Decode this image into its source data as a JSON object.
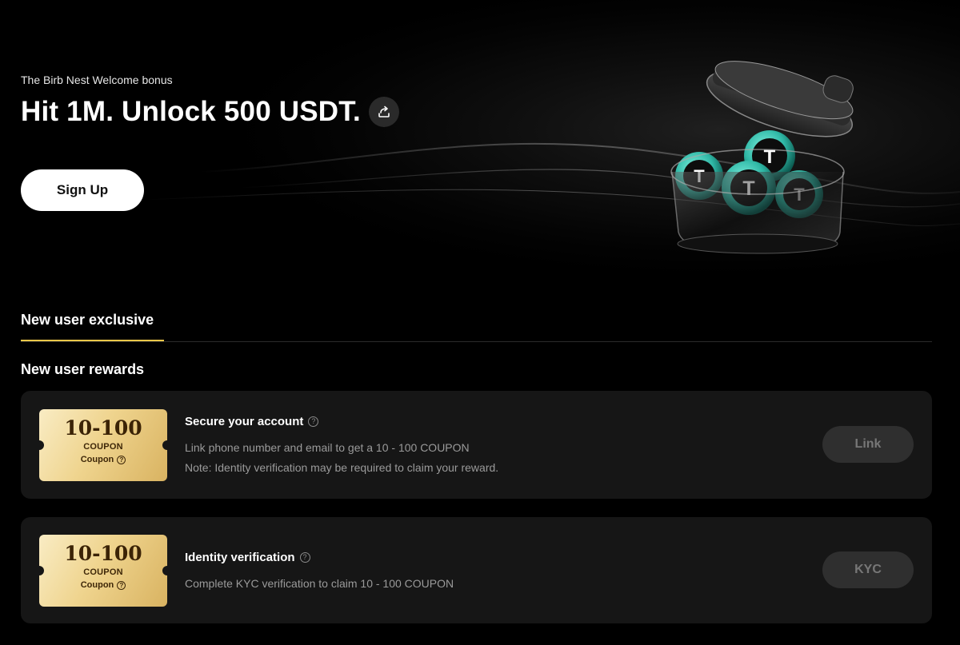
{
  "hero": {
    "subtitle": "The Birb Nest Welcome bonus",
    "headline": "Hit 1M. Unlock 500 USDT.",
    "share_icon": "share-icon",
    "signup_label": "Sign Up"
  },
  "tabs": [
    {
      "label": "New user exclusive",
      "active": true
    }
  ],
  "section_title": "New user rewards",
  "rewards": [
    {
      "coupon_amount": "10-100",
      "coupon_unit": "COUPON",
      "coupon_type": "Coupon",
      "title": "Secure your account",
      "desc1": "Link phone number and email to get a 10 - 100 COUPON",
      "desc2": "Note: Identity verification may be required to claim your reward.",
      "action_label": "Link"
    },
    {
      "coupon_amount": "10-100",
      "coupon_unit": "COUPON",
      "coupon_type": "Coupon",
      "title": "Identity verification",
      "desc1": "Complete KYC verification to claim 10 - 100 COUPON",
      "action_label": "KYC"
    }
  ],
  "colors": {
    "background": "#000000",
    "card": "#161616",
    "accent_tab": "#f0c84a",
    "coin_teal": "#2fb8a6"
  }
}
